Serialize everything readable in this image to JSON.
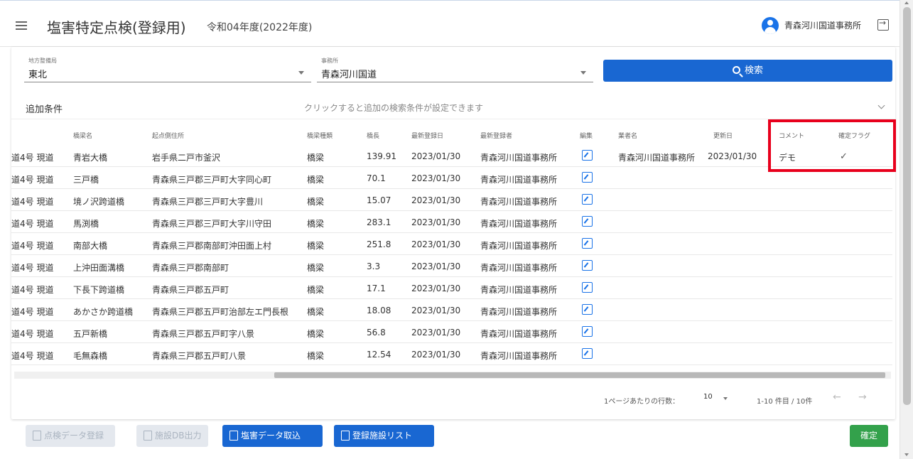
{
  "header": {
    "title": "塩害特定点検(登録用)",
    "fiscal_year": "令和04年度(2022年度)",
    "user_name": "青森河川国道事務所"
  },
  "filters": {
    "region": {
      "label": "地方整備局",
      "value": "東北"
    },
    "office": {
      "label": "事務所",
      "value": "青森河川国道"
    },
    "search_label": "検索"
  },
  "additional_conditions": {
    "label": "追加条件",
    "hint": "クリックすると追加の検索条件が設定できます"
  },
  "table": {
    "columns": [
      "橋梁名",
      "起点側住所",
      "橋梁種類",
      "橋長",
      "最新登録日",
      "最新登録者",
      "編集",
      "業者名",
      "更新日",
      "コメント",
      "確定フラグ"
    ],
    "rows": [
      {
        "route": "道4号 現道",
        "name": "青岩大橋",
        "address": "岩手県二戸市釜沢",
        "type": "橋梁",
        "length": "139.91",
        "reg_date": "2023/01/30",
        "registrant": "青森河川国道事務所",
        "contractor": "青森河川国道事務所",
        "updated": "2023/01/30",
        "comment": "デモ",
        "confirmed": "✓"
      },
      {
        "route": "道4号 現道",
        "name": "三戸橋",
        "address": "青森県三戸郡三戸町大字同心町",
        "type": "橋梁",
        "length": "70.1",
        "reg_date": "2023/01/30",
        "registrant": "青森河川国道事務所",
        "contractor": "",
        "updated": "",
        "comment": "",
        "confirmed": ""
      },
      {
        "route": "道4号 現道",
        "name": "境ノ沢跨道橋",
        "address": "青森県三戸郡三戸町大字豊川",
        "type": "橋梁",
        "length": "15.07",
        "reg_date": "2023/01/30",
        "registrant": "青森河川国道事務所",
        "contractor": "",
        "updated": "",
        "comment": "",
        "confirmed": ""
      },
      {
        "route": "道4号 現道",
        "name": "馬渕橋",
        "address": "青森県三戸郡三戸町大字川守田",
        "type": "橋梁",
        "length": "283.1",
        "reg_date": "2023/01/30",
        "registrant": "青森河川国道事務所",
        "contractor": "",
        "updated": "",
        "comment": "",
        "confirmed": ""
      },
      {
        "route": "道4号 現道",
        "name": "南部大橋",
        "address": "青森県三戸郡南部町沖田面上村",
        "type": "橋梁",
        "length": "251.8",
        "reg_date": "2023/01/30",
        "registrant": "青森河川国道事務所",
        "contractor": "",
        "updated": "",
        "comment": "",
        "confirmed": ""
      },
      {
        "route": "道4号 現道",
        "name": "上沖田面溝橋",
        "address": "青森県三戸郡南部町",
        "type": "橋梁",
        "length": "3.3",
        "reg_date": "2023/01/30",
        "registrant": "青森河川国道事務所",
        "contractor": "",
        "updated": "",
        "comment": "",
        "confirmed": ""
      },
      {
        "route": "道4号 現道",
        "name": "下長下跨道橋",
        "address": "青森県三戸郡五戸町",
        "type": "橋梁",
        "length": "17.1",
        "reg_date": "2023/01/30",
        "registrant": "青森河川国道事務所",
        "contractor": "",
        "updated": "",
        "comment": "",
        "confirmed": ""
      },
      {
        "route": "道4号 現道",
        "name": "あかさか跨道橋",
        "address": "青森県三戸郡五戸町治部左エ門長根",
        "type": "橋梁",
        "length": "18.08",
        "reg_date": "2023/01/30",
        "registrant": "青森河川国道事務所",
        "contractor": "",
        "updated": "",
        "comment": "",
        "confirmed": ""
      },
      {
        "route": "道4号 現道",
        "name": "五戸新橋",
        "address": "青森県三戸郡五戸町字八景",
        "type": "橋梁",
        "length": "56.8",
        "reg_date": "2023/01/30",
        "registrant": "青森河川国道事務所",
        "contractor": "",
        "updated": "",
        "comment": "",
        "confirmed": ""
      },
      {
        "route": "道4号 現道",
        "name": "毛無森橋",
        "address": "青森県三戸郡五戸町八景",
        "type": "橋梁",
        "length": "12.54",
        "reg_date": "2023/01/30",
        "registrant": "青森河川国道事務所",
        "contractor": "",
        "updated": "",
        "comment": "",
        "confirmed": ""
      }
    ]
  },
  "pagination": {
    "rows_per_page_label": "1ページあたりの行数：",
    "rows_per_page": "10",
    "range": "1-10 件目 / 10件",
    "prev": "←",
    "next": "→"
  },
  "footer": {
    "btn_disabled_1": "点検データ登録",
    "btn_disabled_2": "施設DB出力",
    "btn_import": "塩害データ取込",
    "btn_list": "登録施設リスト",
    "btn_confirm": "確定"
  },
  "colors": {
    "primary": "#1967d2",
    "confirm": "#33a14b",
    "highlight": "#e8001c"
  }
}
